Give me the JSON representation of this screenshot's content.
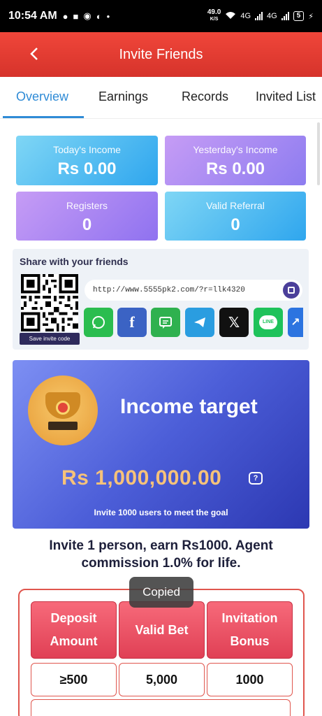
{
  "status_bar": {
    "time": "10:54 AM",
    "net_speed": "49.0",
    "net_unit": "K/S",
    "sim1": "4G",
    "sim2": "4G",
    "battery": "5"
  },
  "header": {
    "title": "Invite Friends"
  },
  "tabs": [
    {
      "label": "Overview",
      "active": true
    },
    {
      "label": "Earnings"
    },
    {
      "label": "Records"
    },
    {
      "label": "Invited List"
    }
  ],
  "stats": {
    "today_income": {
      "label": "Today's Income",
      "value": "Rs 0.00"
    },
    "yesterday_income": {
      "label": "Yesterday's Income",
      "value": "Rs 0.00"
    },
    "registers": {
      "label": "Registers",
      "value": "0"
    },
    "valid_referral": {
      "label": "Valid Referral",
      "value": "0"
    }
  },
  "share": {
    "title": "Share with your friends",
    "link": "http://www.5555pk2.com/?r=llk4320",
    "qr_button": "Save invite code",
    "socials": [
      "whatsapp-icon",
      "facebook-icon",
      "sms-icon",
      "telegram-icon",
      "x-icon",
      "line-icon",
      "more-icon"
    ],
    "line_label": "LINE"
  },
  "target": {
    "title": "Income target",
    "amount": "Rs 1,000,000.00",
    "note": "Invite 1000 users to meet the goal"
  },
  "invite_line": "Invite 1 person, earn Rs1000. Agent commission 1.0% for life.",
  "table": {
    "headers": [
      "Deposit Amount",
      "Valid Bet",
      "Invitation Bonus"
    ],
    "row1": [
      "≥500",
      "5,000",
      "1000"
    ]
  },
  "toast": "Copied",
  "colors": {
    "header": "#e03a30",
    "tab_active": "#2f8bd6",
    "target_amount": "#f6c27a"
  }
}
